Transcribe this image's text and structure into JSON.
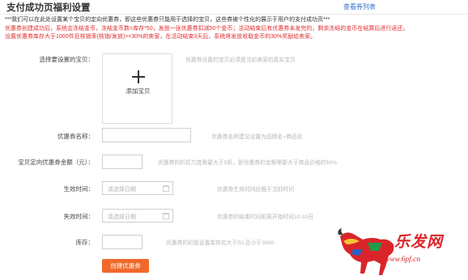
{
  "header": {
    "title": "支付成功页福利设置",
    "list_link": "查看券列表"
  },
  "notices": [
    "***我们可以在此处设置某个宝贝的定向优惠券，即这些优惠券只能用于选择的宝贝，这些券被个性化的展示于用户的支付成功页***",
    "优惠券创建成功后，系统会冻结金币，冻结金币数=库存*50，发放一张优惠券扣减50个金币；活动结束后有优惠券未发完的，剩余冻结的金币在结算后进行返还。",
    "设置优惠券库存大于1000件且核销率(核销/发放)>=30%的卖家，在活动结束3天后，系统将发放收取金币的30%奖励给卖家。"
  ],
  "form": {
    "item": {
      "label": "选择要设置的宝贝：",
      "upload_label": "添加宝贝",
      "hint": "优惠券设置的宝贝必须是当前卖家的真实宝贝"
    },
    "name": {
      "label": "优惠券名称：",
      "value": "",
      "hint": "优惠券名称建议设置为品牌名+商品名"
    },
    "amount": {
      "label": "宝贝定向优惠券金额（元）：",
      "value": "",
      "hint": "优惠券的折扣力度需要大于5折，即优惠券的金额需要大于商品价格的50%"
    },
    "start": {
      "label": "生效时间：",
      "placeholder": "请选择日期",
      "hint": "优惠券生效时间应晚于当前时间"
    },
    "end": {
      "label": "失效时间：",
      "placeholder": "请选择日期",
      "hint": "优惠券的结束时间距离开始时间10-15日"
    },
    "stock": {
      "label": "库存：",
      "value": "",
      "hint": "优惠券的初始设置库存应大于50,且小于3000"
    },
    "submit": "创建优惠券"
  },
  "watermark": {
    "logo_text": "乐发网",
    "url": "www.6pf.cn"
  },
  "colors": {
    "accent": "#f2682a",
    "notice_red": "#e02d2d",
    "link": "#2f6fd0"
  }
}
